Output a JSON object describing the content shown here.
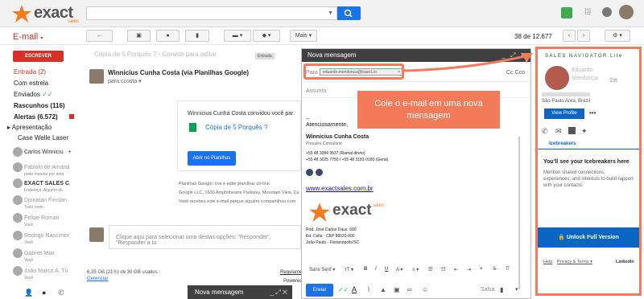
{
  "header": {
    "logo_text": "exact",
    "logo_sub": "sales"
  },
  "toolbar": {
    "section_label": "E-mail",
    "more_label": "Mais",
    "pager_text": "38 de 12.677"
  },
  "sidebar": {
    "compose_label": "ESCREVER",
    "items": [
      {
        "label": "Entrada (2)"
      },
      {
        "label": "Com estrela"
      },
      {
        "label": "Enviados"
      },
      {
        "label": "Rascunhos (116)"
      },
      {
        "label": "Alertas (6.572)"
      },
      {
        "label": "Apresentação"
      },
      {
        "label": "Case Welle Laser"
      }
    ],
    "current_user": "Carlos Winniciu",
    "contacts": [
      {
        "name": "Fabiolo do Amaral",
        "status": "pode mandar por ema"
      },
      {
        "name": "EXACT SALES C",
        "status": "Endereço: Alguém ab"
      },
      {
        "name": "Djonatan Finnian",
        "status": "Tudo certo"
      },
      {
        "name": "Felipe Roman",
        "status": "Você"
      },
      {
        "name": "Rodrigo Nascimer",
        "status": "Você"
      },
      {
        "name": "Gabriel Max",
        "status": "Você"
      },
      {
        "name": "João Marco A. Tu",
        "status": "Você"
      }
    ]
  },
  "message": {
    "subject": "Cópia de 5 Porquês ? - Convite para editar",
    "badge": "Entrada",
    "sender": "Winnicius Cunha Costa (via Planilhas Google)",
    "to": "para ccosta",
    "card_text": "Winnicius Cunha Costa convidou você par",
    "card_link": "Cópia de 5 Porquês ?",
    "card_button": "Abrir no Planilhas",
    "footer_1": "Planilhas Google: crie e edite planilhas on-line.",
    "footer_2": "Google LLC, 1600 Amphitheatre Parkway, Mountain View, Ca",
    "footer_3": "Você recebeu este e-mail porque alguém compartilhou com",
    "reply_prompt": "Clique aqui para selecionar uma destas opções: \"Responder\", \"Responder a to",
    "storage": "6,35 GB (21%) de 30 GB usados",
    "storage_link": "Gerenciar",
    "regulamento": "Regulame",
    "powered": "Powered"
  },
  "compose": {
    "title": "Nova mensagem",
    "para_label": "Para",
    "recipient": "eduardo.mendonca@base1.io",
    "cc_label": "Cc Cco",
    "subject_placeholder": "Assunto",
    "sig_dashes": "--",
    "sig_greeting": "Atenciosamente,",
    "sig_name": "Winnicius Cunha Costa",
    "sig_role": "Presales Consultant",
    "sig_phone1": "+55 48 3084 9537 (Ramal direto)",
    "sig_phone2": "+55 48 3025 7750 / +55 48 3181-0180 (Geral)",
    "sig_site": "www.exactsales.com.br",
    "addr1": "Rod. José Carlos Daux, 600",
    "addr2": "Ed. Celta - CEP 88030-000",
    "addr3": "João Paulo - Florianópolis/SC",
    "font_label": "Sans Serif",
    "send_label": "Enviar",
    "saved_label": "Salva"
  },
  "callout": {
    "text": "Cole o e-mail em uma nova mensagem"
  },
  "second_compose": {
    "title": "Nova mensagem"
  },
  "sales_navigator": {
    "title": "SALES NAVIGATOR Lite",
    "first_name": "Eduardo",
    "last_name": "Mendonça",
    "degree": "1st",
    "location": "São Paulo Area, Brazil",
    "view_profile": "View Profile",
    "icebreakers_tab": "Icebreakers",
    "heading": "You'll see your Icebreakers here",
    "description": "Mention shared connections, experiences, and interests to build rapport with your contacts.",
    "unlock": "Unlock Full Version",
    "help": "Help",
    "privacy": "Privacy & Terms",
    "linkedin": "LinkedIn"
  },
  "colors": {
    "gmail_red": "#d93025",
    "accent_orange": "#f47b5a",
    "linkedin_blue": "#0a66c2",
    "google_blue": "#1a73e8"
  }
}
